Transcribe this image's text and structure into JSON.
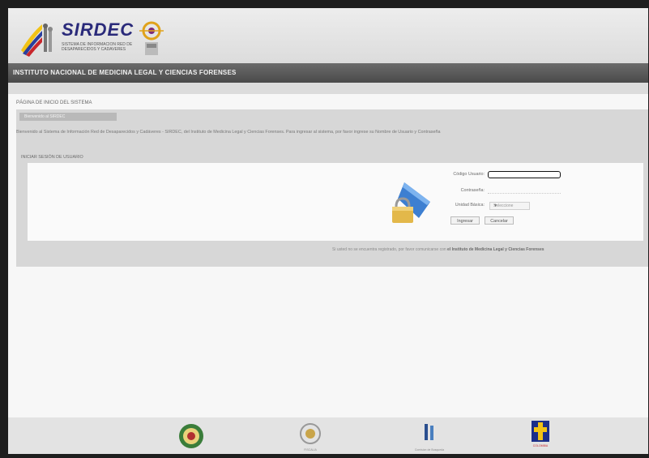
{
  "header": {
    "app_name": "SIRDEC",
    "app_subtitle": "SISTEMA DE INFORMACION RED DE DESAPARECIDOS Y CADAVERES",
    "institution_bar": "INSTITUTO NACIONAL DE MEDICINA LEGAL Y CIENCIAS FORENSES"
  },
  "breadcrumb": "PÁGINA DE INICIO DEL SISTEMA",
  "panel": {
    "tab_label": "Bienvenido al SIRDEC",
    "welcome_text": "Bienvenido al Sistema de Información Red de Desaparecidos y Cadáveres - SIRDEC, del Instituto de Medicina Legal y Ciencias Forenses. Para ingresar al sistema, por favor ingrese su Nombre de Usuario y Contraseña",
    "section_title": "INICIAR SESIÓN DE USUARIO"
  },
  "login": {
    "user_label": "Código Usuario:",
    "user_value": "",
    "password_label": "Contraseña:",
    "password_value": "",
    "entity_label": "Unidad Básica:",
    "entity_selected": "Seleccione",
    "submit_label": "Ingresar",
    "cancel_label": "Cancelar"
  },
  "footnote_prefix": "Si usted no se encuentra registrado, por favor comunicarse con",
  "footnote_org": "el Instituto de Medicina Legal y Ciencias Forenses",
  "footer": {
    "logo_names": [
      "policia-seal-icon",
      "fiscalia-seal-icon",
      "medicina-legal-icon",
      "colombia-icon"
    ],
    "captions": [
      "",
      "FISCALIA",
      "Comision de Busqueda",
      "COLOMBIA"
    ]
  },
  "colors": {
    "topbar": "#555555",
    "panel": "#d7d7d7",
    "logo_text": "#2a2a7a",
    "colombia_badge": "#1c2f8a"
  }
}
